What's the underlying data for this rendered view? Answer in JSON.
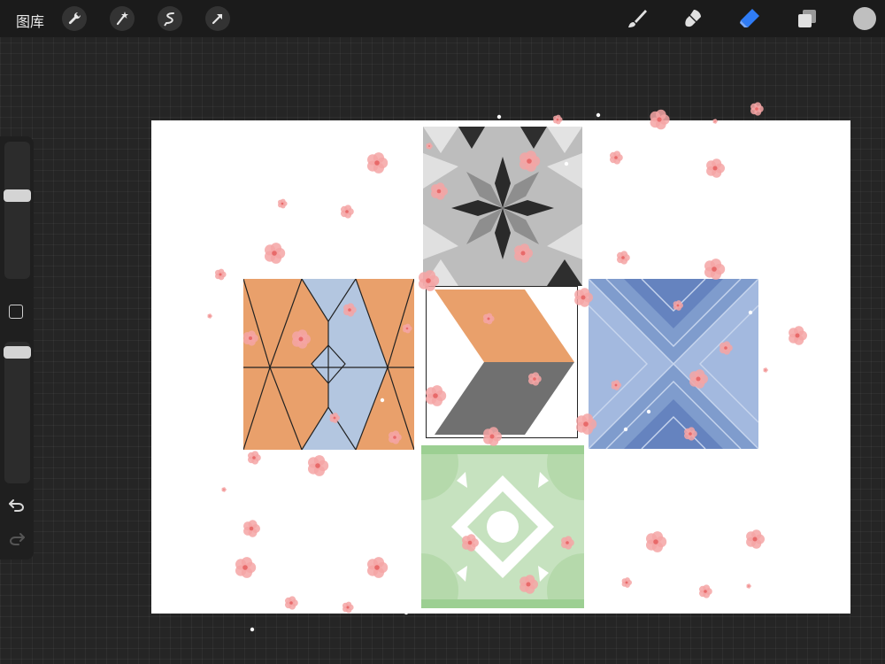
{
  "topbar": {
    "gallery_label": "图库",
    "left_tools": [
      "wrench-icon",
      "magic-wand-icon",
      "selection-icon",
      "transform-arrow-icon"
    ],
    "right_tools": [
      "brush-icon",
      "smudge-icon",
      "eraser-icon",
      "layers-icon"
    ],
    "active_tool": "eraser-icon",
    "current_color": "#bfbfbf",
    "accent_color": "#2f7cf6"
  },
  "sidebar": {
    "controls": [
      "brush-size-slider",
      "modify-button",
      "opacity-slider",
      "undo-icon",
      "redo-icon"
    ]
  },
  "canvas": {
    "background": "#ffffff",
    "tiles": [
      {
        "name": "gray-star-tile",
        "colors": [
          "#b9b9b9",
          "#2a2a2a",
          "#e2e2e2"
        ]
      },
      {
        "name": "orange-blue-kite-tile",
        "colors": [
          "#e9a06b",
          "#b3c6e0",
          "#2a2a2a"
        ]
      },
      {
        "name": "chevron-tile",
        "colors": [
          "#e9a06b",
          "#707070",
          "#ffffff"
        ]
      },
      {
        "name": "blue-stripe-tile",
        "colors": [
          "#6f8fc6",
          "#a9bde0"
        ]
      },
      {
        "name": "green-diamond-tile",
        "colors": [
          "#c6e2bf",
          "#9ccf92",
          "#ffffff"
        ]
      }
    ],
    "petal_color": "#f4a4a4"
  }
}
